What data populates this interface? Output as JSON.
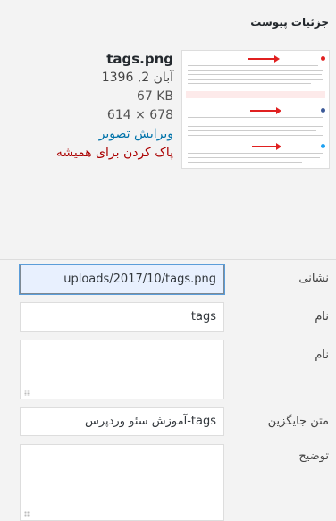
{
  "panel": {
    "title": "جزئیات پیوست"
  },
  "attachment": {
    "filename": "tags.png",
    "date": "آبان 2, 1396",
    "size": "67 KB",
    "dimensions": "614 × 678",
    "edit_link": "ویرایش تصویر",
    "delete_link": "پاک کردن برای همیشه"
  },
  "fields": {
    "url_label": "نشانی",
    "url_value": "uploads/2017/10/tags.png",
    "title_label": "نام",
    "title_value": "tags",
    "caption_label": "نام",
    "caption_value": "",
    "alt_label": "متن جایگزین",
    "alt_value": "tags-آموزش سئو وردپرس",
    "description_label": "توضیح",
    "description_value": ""
  },
  "colors": {
    "link": "#0073aa",
    "delete": "#aa0000",
    "focus_bg": "#e8f0fe"
  }
}
